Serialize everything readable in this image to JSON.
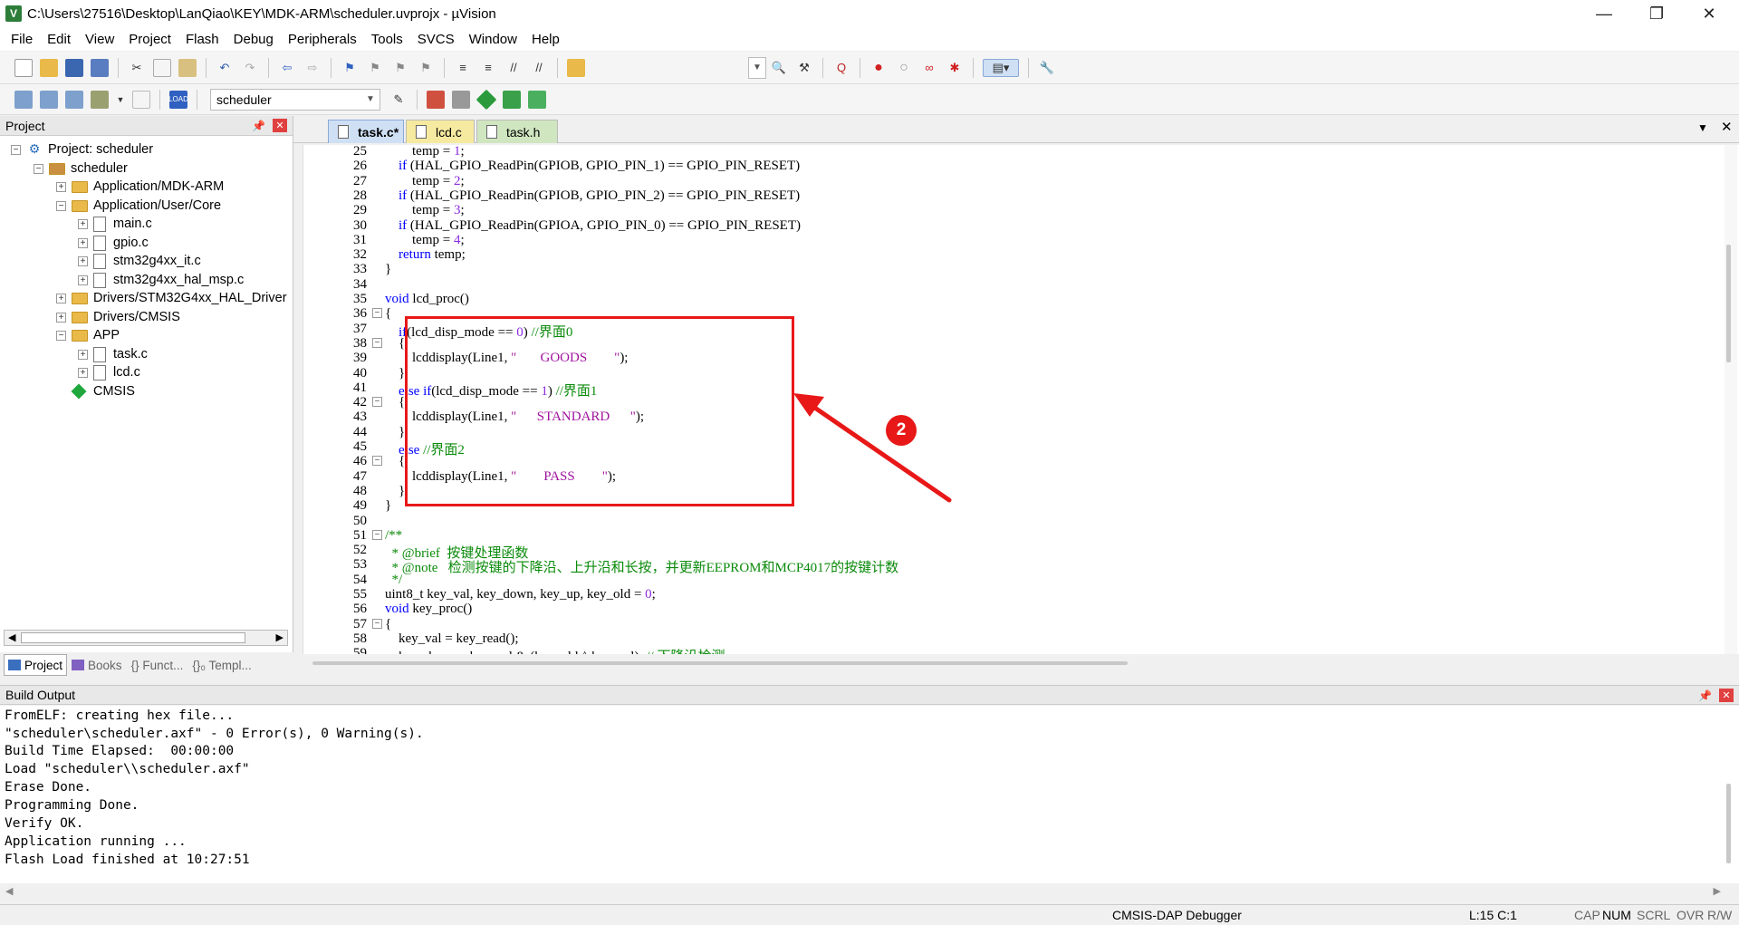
{
  "window": {
    "title": "C:\\Users\\27516\\Desktop\\LanQiao\\KEY\\MDK-ARM\\scheduler.uvprojx - µVision",
    "app_icon_letter": "V",
    "minimize": "—",
    "maximize": "❐",
    "close": "✕"
  },
  "menu": [
    "File",
    "Edit",
    "View",
    "Project",
    "Flash",
    "Debug",
    "Peripherals",
    "Tools",
    "SVCS",
    "Window",
    "Help"
  ],
  "toolbar2": {
    "target": "scheduler"
  },
  "project_panel": {
    "title": "Project",
    "tree": [
      {
        "label": "Project: scheduler",
        "toggle": "−",
        "icon": "project"
      },
      {
        "label": "scheduler",
        "toggle": "−",
        "icon": "target"
      },
      {
        "label": "Application/MDK-ARM",
        "toggle": "+",
        "icon": "folder"
      },
      {
        "label": "Application/User/Core",
        "toggle": "−",
        "icon": "folder"
      },
      {
        "label": "main.c",
        "toggle": "+",
        "icon": "file"
      },
      {
        "label": "gpio.c",
        "toggle": "+",
        "icon": "file"
      },
      {
        "label": "stm32g4xx_it.c",
        "toggle": "+",
        "icon": "file"
      },
      {
        "label": "stm32g4xx_hal_msp.c",
        "toggle": "+",
        "icon": "file"
      },
      {
        "label": "Drivers/STM32G4xx_HAL_Driver",
        "toggle": "+",
        "icon": "folder"
      },
      {
        "label": "Drivers/CMSIS",
        "toggle": "+",
        "icon": "folder"
      },
      {
        "label": "APP",
        "toggle": "−",
        "icon": "folder"
      },
      {
        "label": "task.c",
        "toggle": "+",
        "icon": "file"
      },
      {
        "label": "lcd.c",
        "toggle": "+",
        "icon": "file"
      },
      {
        "label": "CMSIS",
        "toggle": "",
        "icon": "gem"
      }
    ],
    "tabs": [
      "Project",
      "Books",
      "{} Funct...",
      "{}₀ Templ..."
    ]
  },
  "editor": {
    "tabs": [
      {
        "label": "task.c*",
        "active": true,
        "color": "#cfe0f5"
      },
      {
        "label": "lcd.c",
        "active": false,
        "color": "#f6eaa0"
      },
      {
        "label": "task.h",
        "active": false,
        "color": "#cfe6c0"
      }
    ],
    "lines": [
      {
        "n": "25",
        "fold": "",
        "code": [
          [
            "",
            "        temp = "
          ],
          [
            "num",
            "1"
          ],
          [
            "",
            ";"
          ]
        ]
      },
      {
        "n": "26",
        "fold": "",
        "code": [
          [
            "kw",
            "    if"
          ],
          [
            "",
            " (HAL_GPIO_ReadPin(GPIOB, GPIO_PIN_1) == GPIO_PIN_RESET)"
          ]
        ]
      },
      {
        "n": "27",
        "fold": "",
        "code": [
          [
            "",
            "        temp = "
          ],
          [
            "num",
            "2"
          ],
          [
            "",
            ";"
          ]
        ]
      },
      {
        "n": "28",
        "fold": "",
        "code": [
          [
            "kw",
            "    if"
          ],
          [
            "",
            " (HAL_GPIO_ReadPin(GPIOB, GPIO_PIN_2) == GPIO_PIN_RESET)"
          ]
        ]
      },
      {
        "n": "29",
        "fold": "",
        "code": [
          [
            "",
            "        temp = "
          ],
          [
            "num",
            "3"
          ],
          [
            "",
            ";"
          ]
        ]
      },
      {
        "n": "30",
        "fold": "",
        "code": [
          [
            "kw",
            "    if"
          ],
          [
            "",
            " (HAL_GPIO_ReadPin(GPIOA, GPIO_PIN_0) == GPIO_PIN_RESET)"
          ]
        ]
      },
      {
        "n": "31",
        "fold": "",
        "code": [
          [
            "",
            "        temp = "
          ],
          [
            "num",
            "4"
          ],
          [
            "",
            ";"
          ]
        ]
      },
      {
        "n": "32",
        "fold": "",
        "code": [
          [
            "kw",
            "    return"
          ],
          [
            "",
            " temp;"
          ]
        ]
      },
      {
        "n": "33",
        "fold": "",
        "code": [
          [
            "",
            "}"
          ]
        ]
      },
      {
        "n": "34",
        "fold": "",
        "code": [
          [
            "",
            ""
          ]
        ]
      },
      {
        "n": "35",
        "fold": "",
        "code": [
          [
            "kw",
            "void"
          ],
          [
            "",
            " lcd_proc()"
          ]
        ]
      },
      {
        "n": "36",
        "fold": "−",
        "code": [
          [
            "",
            "{"
          ]
        ]
      },
      {
        "n": "37",
        "fold": "",
        "code": [
          [
            "kw",
            "    if"
          ],
          [
            "",
            "(lcd_disp_mode == "
          ],
          [
            "num",
            "0"
          ],
          [
            "",
            ") "
          ],
          [
            "cmt",
            "//界面0"
          ]
        ]
      },
      {
        "n": "38",
        "fold": "−",
        "code": [
          [
            "",
            "    {"
          ]
        ]
      },
      {
        "n": "39",
        "fold": "",
        "code": [
          [
            "",
            "        lcddisplay(Line1, "
          ],
          [
            "str",
            "\"       GOODS        \""
          ],
          [
            "",
            ");"
          ]
        ]
      },
      {
        "n": "40",
        "fold": "",
        "code": [
          [
            "",
            "    }"
          ]
        ]
      },
      {
        "n": "41",
        "fold": "",
        "code": [
          [
            "kw",
            "    else if"
          ],
          [
            "",
            "(lcd_disp_mode == "
          ],
          [
            "num",
            "1"
          ],
          [
            "",
            ") "
          ],
          [
            "cmt",
            "//界面1"
          ]
        ]
      },
      {
        "n": "42",
        "fold": "−",
        "code": [
          [
            "",
            "    {"
          ]
        ]
      },
      {
        "n": "43",
        "fold": "",
        "code": [
          [
            "",
            "        lcddisplay(Line1, "
          ],
          [
            "str",
            "\"      STANDARD      \""
          ],
          [
            "",
            ");"
          ]
        ]
      },
      {
        "n": "44",
        "fold": "",
        "code": [
          [
            "",
            "    }"
          ]
        ]
      },
      {
        "n": "45",
        "fold": "",
        "code": [
          [
            "kw",
            "    else"
          ],
          [
            "",
            " "
          ],
          [
            "cmt",
            "//界面2"
          ]
        ]
      },
      {
        "n": "46",
        "fold": "−",
        "code": [
          [
            "",
            "    {"
          ]
        ]
      },
      {
        "n": "47",
        "fold": "",
        "code": [
          [
            "",
            "        lcddisplay(Line1, "
          ],
          [
            "str",
            "\"        PASS        \""
          ],
          [
            "",
            ");"
          ]
        ]
      },
      {
        "n": "48",
        "fold": "",
        "code": [
          [
            "",
            "    }"
          ]
        ]
      },
      {
        "n": "49",
        "fold": "",
        "code": [
          [
            "",
            "}"
          ]
        ]
      },
      {
        "n": "50",
        "fold": "",
        "code": [
          [
            "",
            ""
          ]
        ]
      },
      {
        "n": "51",
        "fold": "−",
        "code": [
          [
            "cmt",
            "/**"
          ]
        ]
      },
      {
        "n": "52",
        "fold": "",
        "code": [
          [
            "cmt",
            "  * @brief  按键处理函数"
          ]
        ]
      },
      {
        "n": "53",
        "fold": "",
        "code": [
          [
            "cmt",
            "  * @note   检测按键的下降沿、上升沿和长按，并更新EEPROM和MCP4017的按键计数"
          ]
        ]
      },
      {
        "n": "54",
        "fold": "",
        "code": [
          [
            "cmt",
            "  */"
          ]
        ]
      },
      {
        "n": "55",
        "fold": "",
        "code": [
          [
            "",
            "uint8_t key_val, key_down, key_up, key_old = "
          ],
          [
            "num",
            "0"
          ],
          [
            "",
            ";"
          ]
        ]
      },
      {
        "n": "56",
        "fold": "",
        "code": [
          [
            "kw",
            "void"
          ],
          [
            "",
            " key_proc()"
          ]
        ]
      },
      {
        "n": "57",
        "fold": "−",
        "code": [
          [
            "",
            "{"
          ]
        ]
      },
      {
        "n": "58",
        "fold": "",
        "code": [
          [
            "",
            "    key_val = key_read();"
          ]
        ]
      },
      {
        "n": "59",
        "fold": "",
        "code": [
          [
            "",
            "    key_down = key_val & (key_old ^ key_val); "
          ],
          [
            "cmt",
            "// 下降沿检测"
          ]
        ]
      }
    ]
  },
  "annotation": {
    "badge": "2"
  },
  "build_output": {
    "title": "Build Output",
    "lines": [
      "FromELF: creating hex file...",
      "\"scheduler\\scheduler.axf\" - 0 Error(s), 0 Warning(s).",
      "Build Time Elapsed:  00:00:00",
      "Load \"scheduler\\\\scheduler.axf\"",
      "Erase Done.",
      "Programming Done.",
      "Verify OK.",
      "Application running ...",
      "Flash Load finished at 10:27:51"
    ]
  },
  "statusbar": {
    "debugger": "CMSIS-DAP Debugger",
    "position": "L:15 C:1",
    "caps": "CAP",
    "num": "NUM",
    "scrl": "SCRL",
    "ovr": "OVR",
    "rw": "R/W"
  },
  "colors": {
    "highlight": "#e81818",
    "keyword": "#0000ff",
    "comment": "#0a8a0a",
    "number": "#8b2be2",
    "string": "#a0139e"
  }
}
